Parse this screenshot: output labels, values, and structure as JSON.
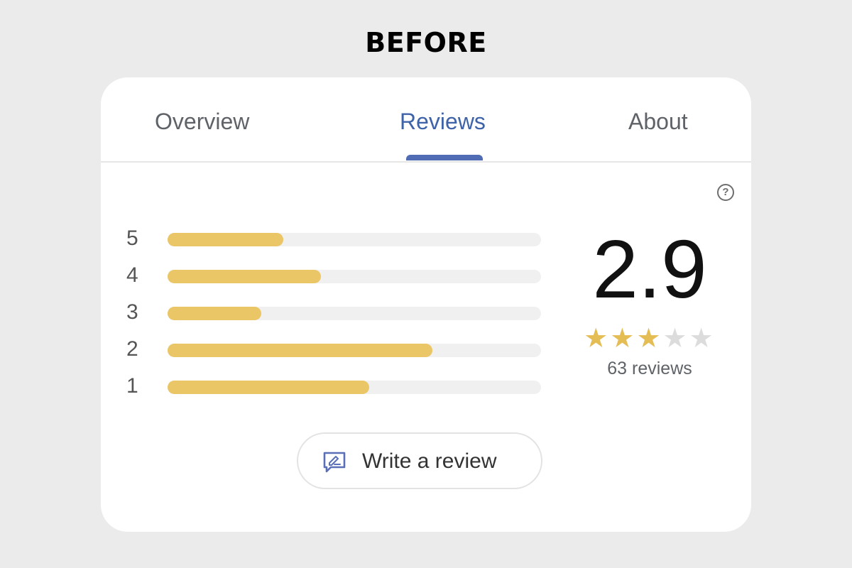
{
  "heading": "BEFORE",
  "tabs": [
    {
      "label": "Overview",
      "active": false
    },
    {
      "label": "Reviews",
      "active": true
    },
    {
      "label": "About",
      "active": false
    }
  ],
  "help_icon": "help-circle-icon",
  "distribution": [
    {
      "stars": "5",
      "fraction": 0.31
    },
    {
      "stars": "4",
      "fraction": 0.41
    },
    {
      "stars": "3",
      "fraction": 0.25
    },
    {
      "stars": "2",
      "fraction": 0.71
    },
    {
      "stars": "1",
      "fraction": 0.54
    }
  ],
  "summary": {
    "rating": "2.9",
    "stars_filled": 3,
    "stars_total": 5,
    "count": "63 reviews"
  },
  "write_review": {
    "label": "Write a review",
    "icon": "edit-review-icon"
  },
  "colors": {
    "bar_fill": "#eac666",
    "bar_track": "#f0f0f0",
    "active_tab": "#3f63a9",
    "star_on": "#e4bd55",
    "star_off": "#dcdcdc"
  }
}
